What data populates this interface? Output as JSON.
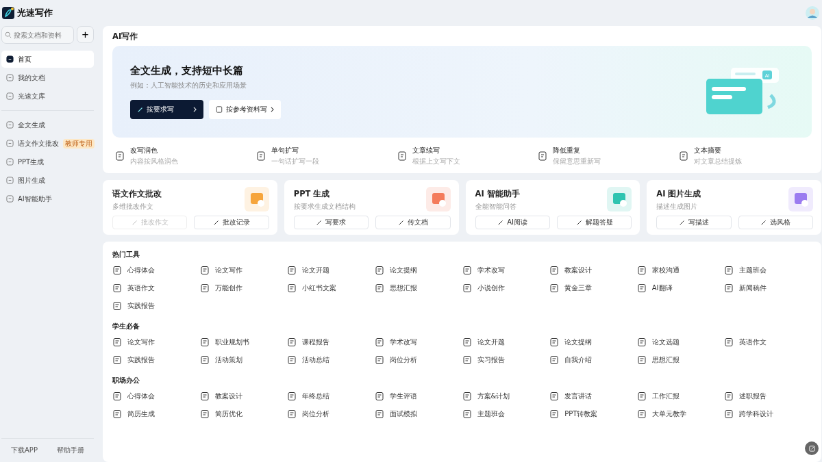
{
  "app": {
    "name": "光速写作"
  },
  "sidebar": {
    "search": {
      "placeholder": "搜索文档和资料"
    },
    "add_button": "+",
    "items": [
      {
        "label": "首页",
        "selected": true
      },
      {
        "label": "我的文档",
        "selected": false
      },
      {
        "label": "光速文库",
        "selected": false
      }
    ],
    "tools": [
      {
        "label": "全文生成"
      },
      {
        "label": "语文作文批改",
        "badge": "教师专用"
      },
      {
        "label": "PPT生成"
      },
      {
        "label": "图片生成"
      },
      {
        "label": "AI智能助手"
      }
    ],
    "footer": [
      "下载APP",
      "帮助手册"
    ]
  },
  "section_title": "AI写作",
  "hero": {
    "title": "全文生成，支持短中长篇",
    "example": "例如：人工智能技术的历史和应用场景",
    "primary": "按要求写",
    "secondary": "按参考资料写",
    "badge": "AI"
  },
  "features": [
    {
      "title": "改写润色",
      "sub": "内容按风格润色"
    },
    {
      "title": "单句扩写",
      "sub": "一句话扩写一段"
    },
    {
      "title": "文章续写",
      "sub": "根据上文写下文"
    },
    {
      "title": "降低重复",
      "sub": "保留意思重新写"
    },
    {
      "title": "文本摘要",
      "sub": "对文章总结提炼"
    }
  ],
  "cards": [
    {
      "title": "语文作文批改",
      "sub": "多维批改作文",
      "color": "#f6a53c",
      "buttons": [
        {
          "label": "批改作文",
          "disabled": true
        },
        {
          "label": "批改记录",
          "disabled": false
        }
      ]
    },
    {
      "title": "PPT 生成",
      "sub": "按要求生成文档结构",
      "color": "#f47c5c",
      "buttons": [
        {
          "label": "写要求",
          "disabled": false
        },
        {
          "label": "传文档",
          "disabled": false
        }
      ]
    },
    {
      "title": "AI 智能助手",
      "sub": "全能智能问答",
      "color": "#2ec4b0",
      "buttons": [
        {
          "label": "AI阅读",
          "disabled": false
        },
        {
          "label": "解题答疑",
          "disabled": false
        }
      ]
    },
    {
      "title": "AI 图片生成",
      "sub": "描述生成图片",
      "color": "#9b7cf0",
      "buttons": [
        {
          "label": "写描述",
          "disabled": false
        },
        {
          "label": "选风格",
          "disabled": false
        }
      ]
    }
  ],
  "groups": [
    {
      "title": "热门工具",
      "tools": [
        "心得体会",
        "论文写作",
        "论文开题",
        "论文提纲",
        "学术改写",
        "教案设计",
        "家校沟通",
        "主题班会",
        "英语作文",
        "万能创作",
        "小红书文案",
        "思想汇报",
        "小说创作",
        "黄金三章",
        "AI翻译",
        "新闻稿件",
        "实践报告"
      ]
    },
    {
      "title": "学生必备",
      "tools": [
        "论文写作",
        "职业规划书",
        "课程报告",
        "学术改写",
        "论文开题",
        "论文提纲",
        "论文选题",
        "英语作文",
        "实践报告",
        "活动策划",
        "活动总结",
        "岗位分析",
        "实习报告",
        "自我介绍",
        "思想汇报"
      ]
    },
    {
      "title": "职场办公",
      "tools": [
        "心得体会",
        "教案设计",
        "年终总结",
        "学生评语",
        "方案&计划",
        "发言讲话",
        "工作汇报",
        "述职报告",
        "简历生成",
        "简历优化",
        "岗位分析",
        "面试模拟",
        "主题班会",
        "PPT转教案",
        "大单元教学",
        "跨学科设计"
      ]
    }
  ]
}
